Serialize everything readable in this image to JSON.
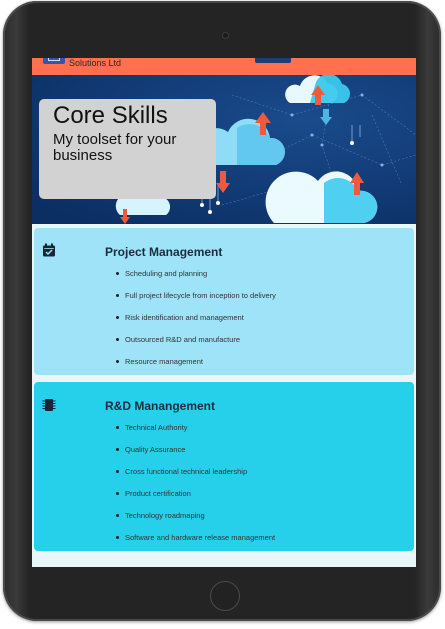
{
  "header": {
    "brand_text": "Solutions Ltd"
  },
  "hero": {
    "title": "Core Skills",
    "subtitle": "My toolset for your business"
  },
  "cards": [
    {
      "title": "Project Management",
      "icon": "calendar-check-icon",
      "items": [
        "Scheduling and planning",
        "Full project lifecycle from inception to delivery",
        "Risk identification and management",
        "Outsourced R&D and manufacture",
        "Resource management"
      ]
    },
    {
      "title": "R&D Manangement",
      "icon": "microchip-icon",
      "items": [
        "Technical Authority",
        "Quality Assurance",
        "Cross functional technical leadership",
        "Product certification",
        "Technology roadmaping",
        "Software and hardware release management"
      ]
    }
  ],
  "colors": {
    "header_bar": "#ff6f50",
    "hero_bg": "#0e3673",
    "card1_bg": "#9ee3f7",
    "card2_bg": "#27d0ea",
    "device_frame": "#242424"
  }
}
